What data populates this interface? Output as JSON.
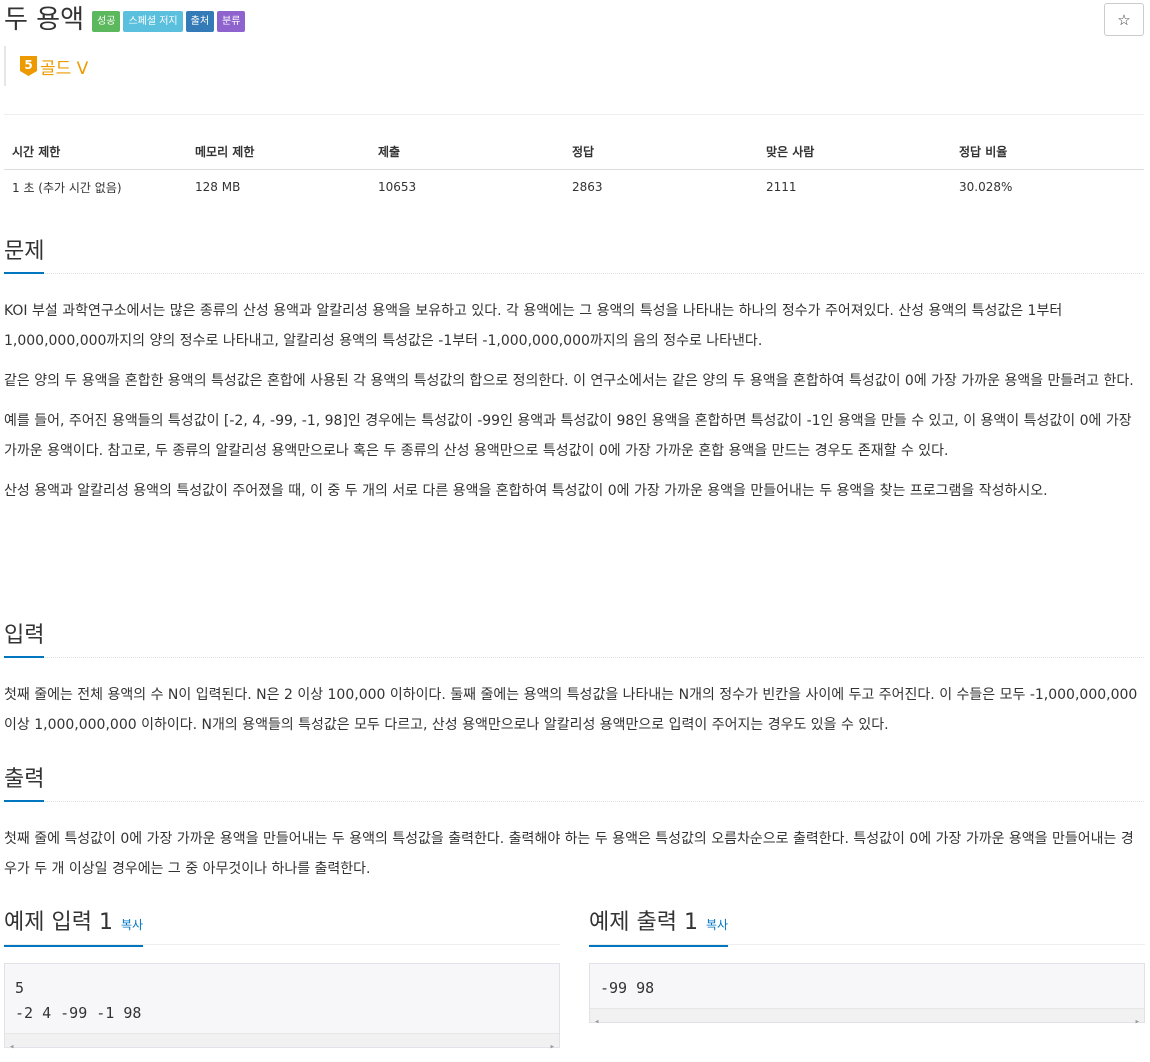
{
  "problem": {
    "title": "두 용액",
    "badges": [
      {
        "label": "성공",
        "color": "#5cb85c"
      },
      {
        "label": "스페셜 저지",
        "color": "#5bc0de"
      },
      {
        "label": "출처",
        "color": "#337ab7"
      },
      {
        "label": "분류",
        "color": "#8e63ce"
      }
    ],
    "star_icon": "☆",
    "tier": {
      "level": "5",
      "label": "골드 V",
      "color": "#ec9a00"
    }
  },
  "stats": {
    "headers": [
      "시간 제한",
      "메모리 제한",
      "제출",
      "정답",
      "맞은 사람",
      "정답 비율"
    ],
    "values": [
      "1 초 (추가 시간 없음)",
      "128 MB",
      "10653",
      "2863",
      "2111",
      "30.028%"
    ]
  },
  "sections": {
    "problem": {
      "title": "문제",
      "paragraphs": [
        "KOI 부설 과학연구소에서는 많은 종류의 산성 용액과 알칼리성 용액을 보유하고 있다. 각 용액에는 그 용액의 특성을 나타내는 하나의 정수가 주어져있다.  산성 용액의 특성값은 1부터 1,000,000,000까지의 양의 정수로 나타내고, 알칼리성 용액의 특성값은 -1부터 -1,000,000,000까지의 음의 정수로 나타낸다.",
        "같은 양의 두 용액을 혼합한 용액의 특성값은 혼합에 사용된 각 용액의 특성값의 합으로 정의한다. 이 연구소에서는 같은 양의 두 용액을 혼합하여 특성값이 0에 가장 가까운 용액을 만들려고 한다.",
        "예를 들어, 주어진 용액들의 특성값이 [-2, 4, -99, -1, 98]인 경우에는 특성값이 -99인 용액과 특성값이 98인 용액을 혼합하면 특성값이 -1인 용액을 만들 수 있고, 이 용액이 특성값이 0에 가장 가까운 용액이다. 참고로, 두 종류의 알칼리성 용액만으로나 혹은 두 종류의 산성 용액만으로 특성값이 0에 가장 가까운 혼합 용액을 만드는 경우도 존재할 수 있다.",
        "산성 용액과 알칼리성 용액의 특성값이 주어졌을 때, 이 중 두 개의 서로 다른 용액을 혼합하여 특성값이 0에 가장 가까운 용액을 만들어내는 두 용액을 찾는 프로그램을 작성하시오."
      ]
    },
    "input": {
      "title": "입력",
      "paragraphs": [
        "첫째 줄에는 전체 용액의 수 N이 입력된다. N은 2 이상 100,000 이하이다. 둘째 줄에는 용액의 특성값을 나타내는 N개의 정수가 빈칸을 사이에 두고 주어진다. 이 수들은 모두 -1,000,000,000 이상 1,000,000,000 이하이다. N개의 용액들의 특성값은 모두 다르고, 산성 용액만으로나 알칼리성 용액만으로 입력이 주어지는 경우도 있을 수 있다."
      ]
    },
    "output": {
      "title": "출력",
      "paragraphs": [
        "첫째 줄에 특성값이 0에 가장 가까운 용액을 만들어내는 두 용액의 특성값을 출력한다. 출력해야 하는 두 용액은 특성값의 오름차순으로 출력한다. 특성값이 0에 가장 가까운 용액을 만들어내는 경우가 두 개 이상일 경우에는 그 중 아무것이나 하나를 출력한다."
      ]
    }
  },
  "samples": {
    "input": {
      "title": "예제 입력 1",
      "copy_label": "복사",
      "lines": [
        "5",
        "-2 4 -99 -1 98"
      ]
    },
    "output": {
      "title": "예제 출력 1",
      "copy_label": "복사",
      "lines": [
        "-99 98"
      ]
    },
    "scroll_left": "◂",
    "scroll_right": "▸"
  }
}
